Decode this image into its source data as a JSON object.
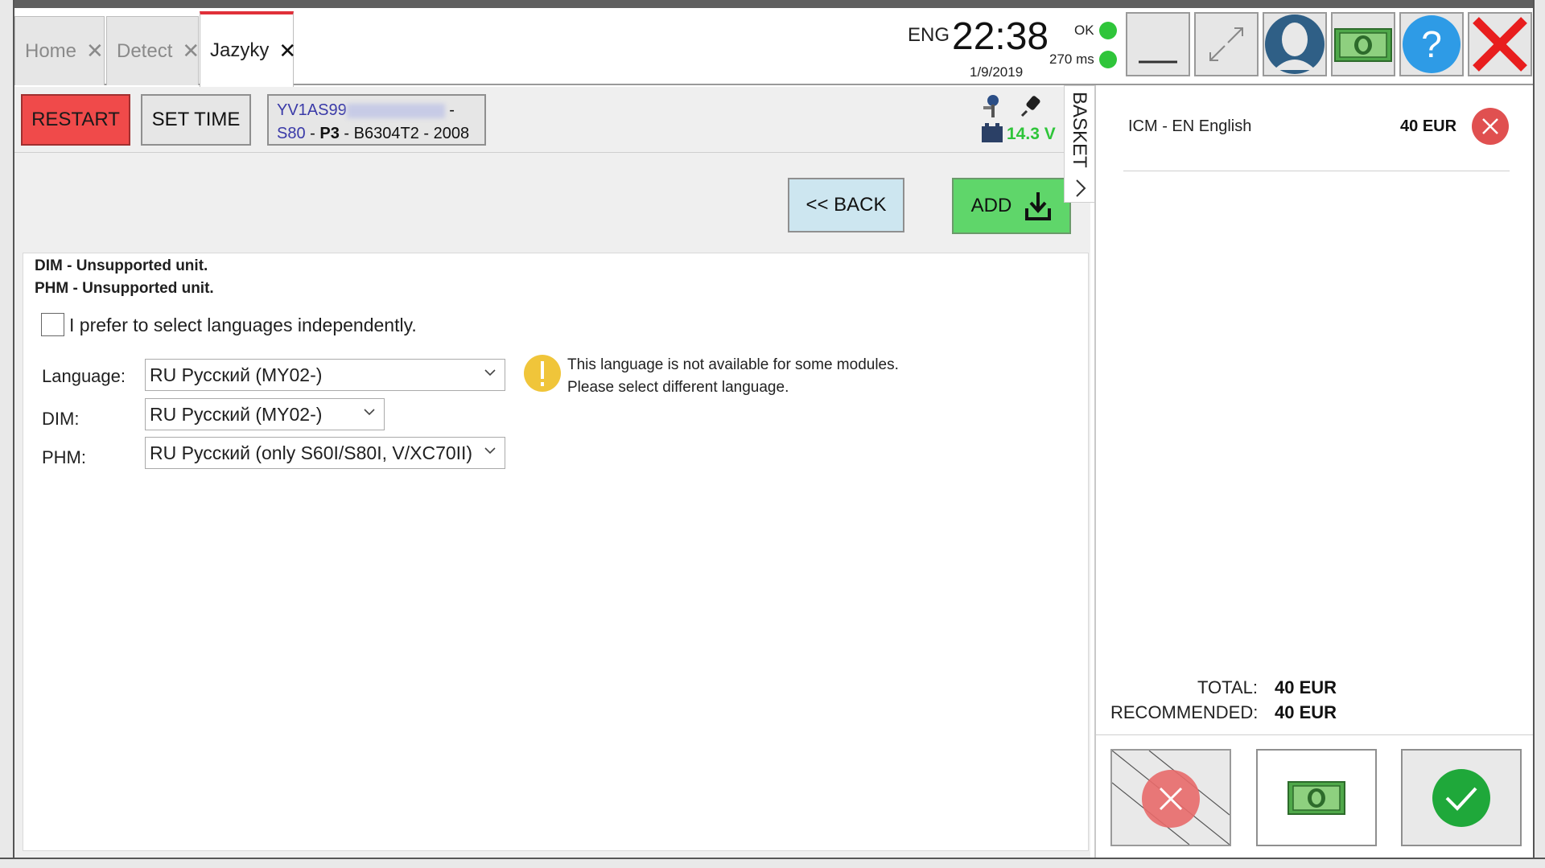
{
  "tabs": [
    {
      "label": "Home"
    },
    {
      "label": "Detect"
    },
    {
      "label": "Jazyky"
    }
  ],
  "status": {
    "lang": "ENG",
    "time": "22:38",
    "date": "1/9/2019",
    "conn_ok": "OK",
    "latency": "270 ms"
  },
  "toolbar": {
    "restart_label": "RESTART",
    "set_time_label": "SET TIME",
    "vehicle": {
      "vin_prefix": "YV1AS99",
      "vin_dash": "-",
      "model": "S80",
      "platform": "P3",
      "engine": "B6304T2",
      "year": "2008",
      "sep": "-"
    },
    "voltage": "14.3 V"
  },
  "actions": {
    "back_label": "<< BACK",
    "add_label": "ADD"
  },
  "messages": [
    "DIM - Unsupported unit.",
    "PHM - Unsupported unit."
  ],
  "prefer_checkbox": {
    "label": "I prefer to select languages independently.",
    "checked": false
  },
  "fields": {
    "language": {
      "label": "Language:",
      "value": "RU Русский (MY02-)"
    },
    "dim": {
      "label": "DIM:",
      "value": "RU Русский (MY02-)"
    },
    "phm": {
      "label": "PHM:",
      "value": "RU Русский (only S60I/S80I, V/XC70II)"
    }
  },
  "warning": {
    "line1": "This language is not available for some modules.",
    "line2": "Please select different language."
  },
  "basket": {
    "tab_label": "BASKET",
    "items": [
      {
        "name": "ICM - EN English",
        "price": "40",
        "currency": "EUR"
      }
    ],
    "total_label": "TOTAL:",
    "total_value": "40 EUR",
    "recommended_label": "RECOMMENDED:",
    "recommended_value": "40 EUR"
  },
  "colors": {
    "restart": "#f04a4a",
    "add": "#5fd66a",
    "back": "#cde6f0",
    "ok_dot": "#2fc53a",
    "voltage": "#2fc53a",
    "close_red": "#e81e1e",
    "help_blue": "#2e9be6",
    "warning_yellow": "#f0c53a",
    "accept_green": "#1fa83a",
    "remove_red": "#e05050"
  }
}
